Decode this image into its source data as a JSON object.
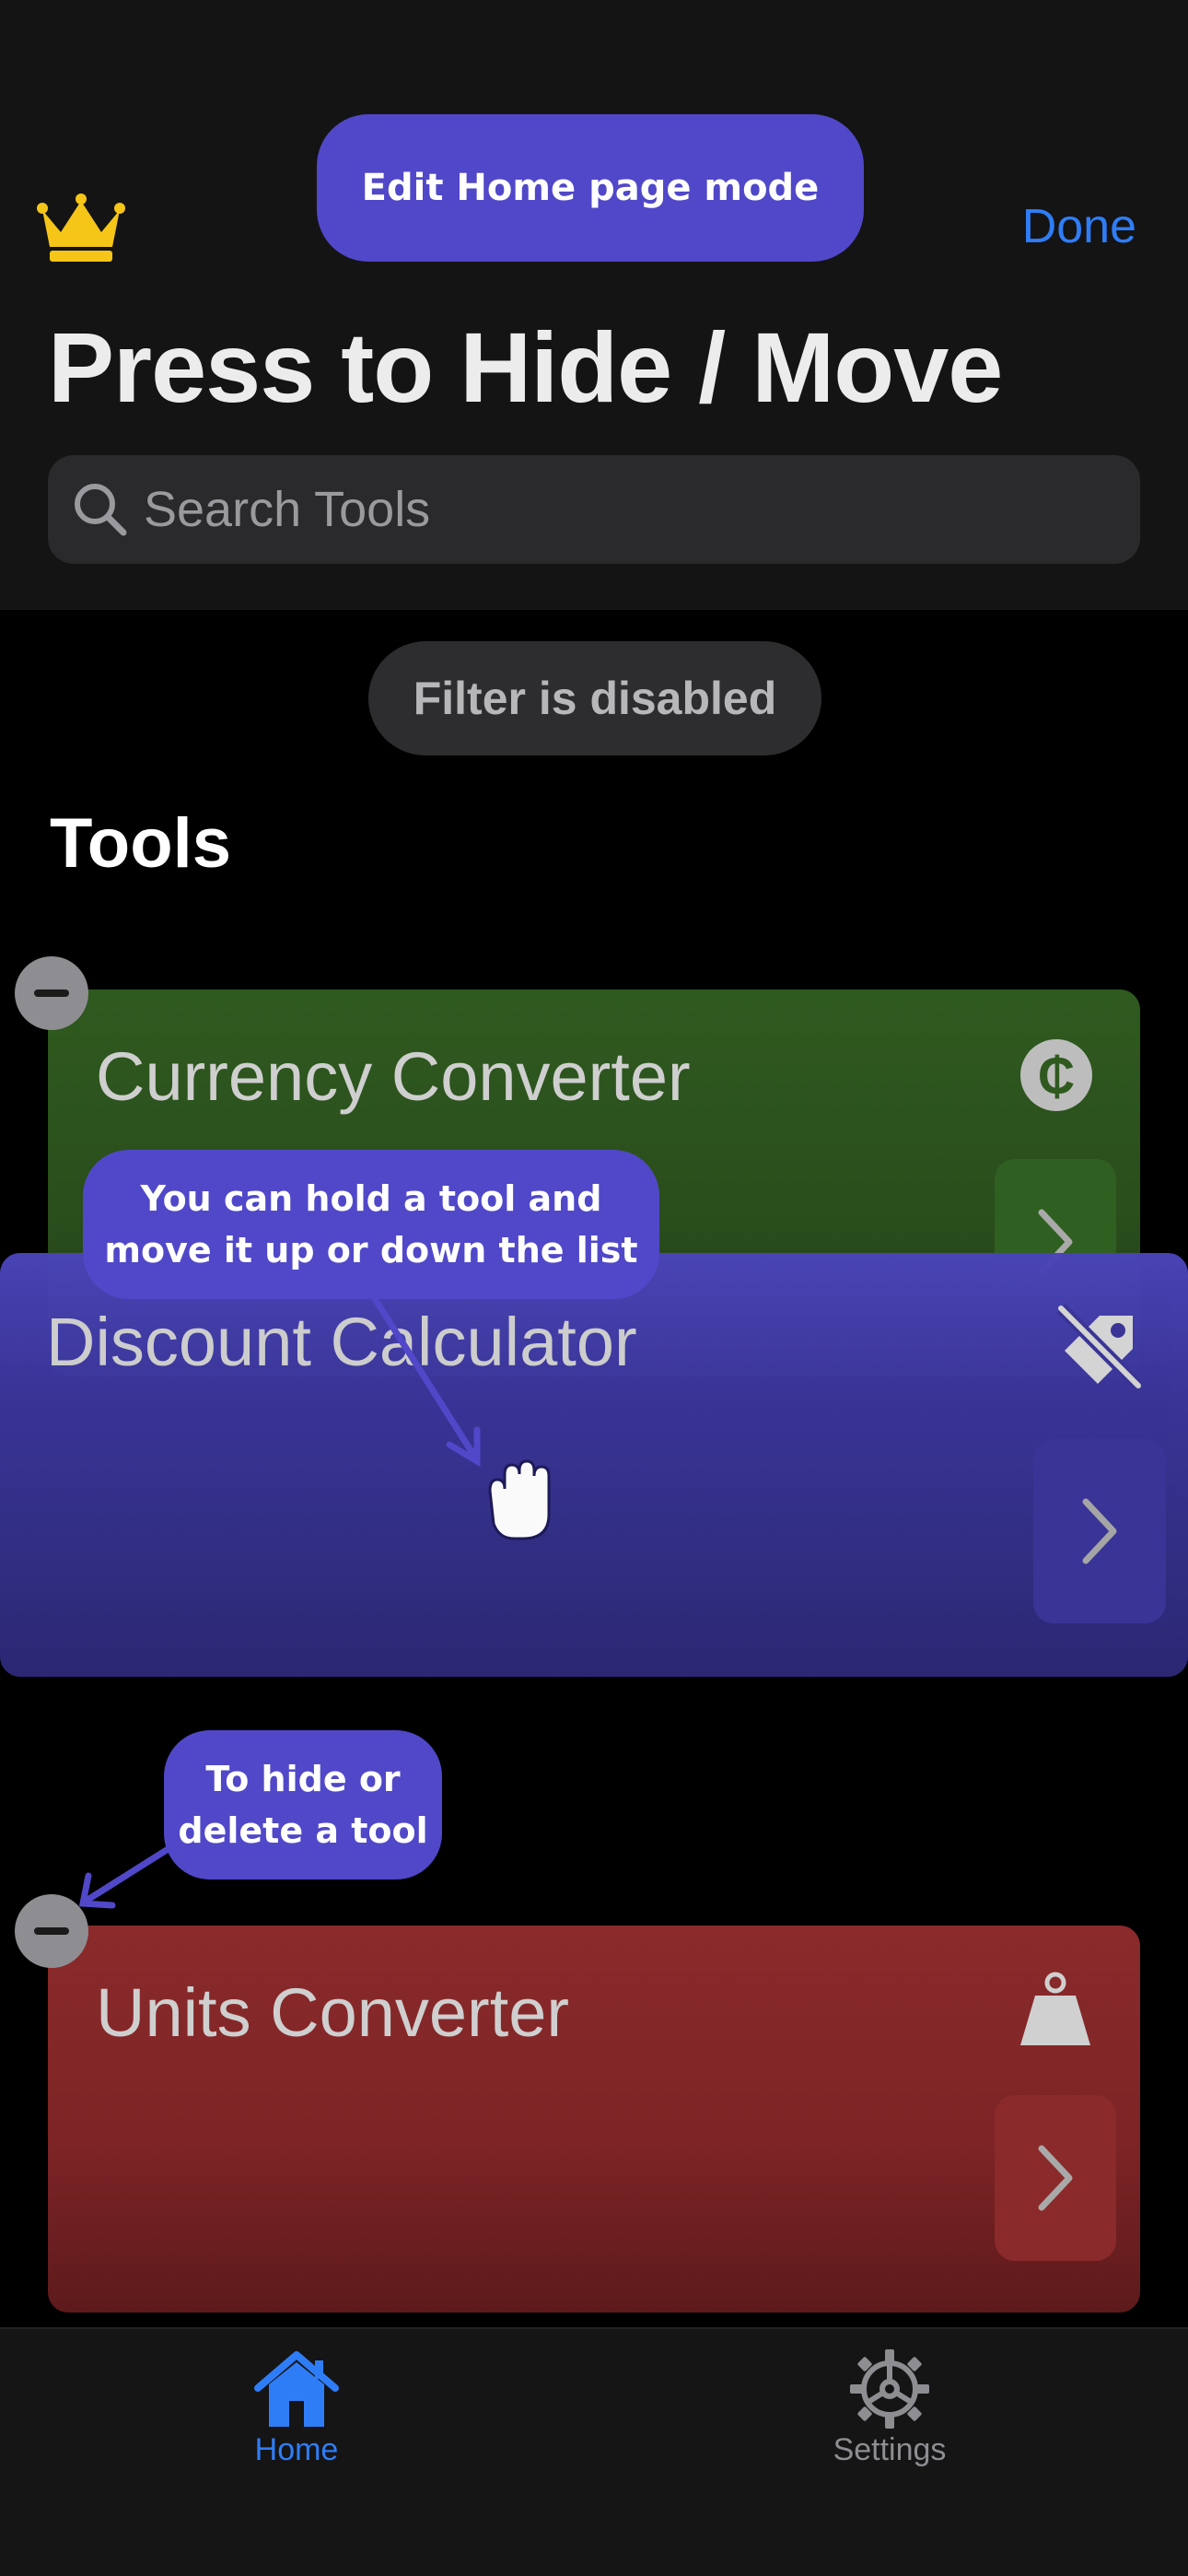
{
  "header": {
    "done_label": "Done",
    "title": "Press to Hide / Move",
    "edit_mode_label": "Edit Home page mode"
  },
  "search": {
    "placeholder": "Search Tools"
  },
  "filter": {
    "label": "Filter is disabled"
  },
  "section": {
    "title": "Tools"
  },
  "tools": [
    {
      "name": "Currency Converter",
      "icon": "currency-icon",
      "icon_glyph": "₵",
      "color": "#2f5a1f"
    },
    {
      "name": "Discount Calculator",
      "icon": "tag-slash-icon",
      "color": "#3b3599"
    },
    {
      "name": "Units Converter",
      "icon": "weight-icon",
      "color": "#8a2a2b"
    }
  ],
  "tips": {
    "move_line1": "You can hold a tool and",
    "move_line2": "move it up or down the list",
    "hide_line1": "To hide or",
    "hide_line2": "delete a tool"
  },
  "tabs": [
    {
      "label": "Home",
      "icon": "house-icon",
      "active": true
    },
    {
      "label": "Settings",
      "icon": "gear-icon",
      "active": false
    }
  ],
  "colors": {
    "accent": "#2f7df6",
    "tip": "#5048c8",
    "crown": "#f5c518"
  }
}
